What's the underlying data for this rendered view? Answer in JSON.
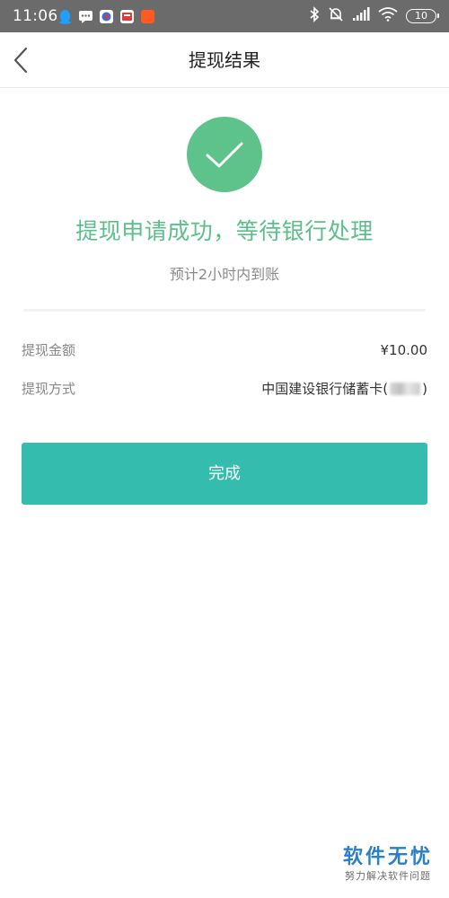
{
  "status_bar": {
    "time": "11:06",
    "battery": "10"
  },
  "header": {
    "title": "提现结果"
  },
  "result": {
    "title": "提现申请成功，等待银行处理",
    "subtitle": "预计2小时内到账"
  },
  "details": [
    {
      "label": "提现金额",
      "value": "¥10.00"
    },
    {
      "label": "提现方式",
      "value_prefix": "中国建设银行储蓄卡(",
      "value_suffix": ")"
    }
  ],
  "actions": {
    "finish_label": "完成"
  },
  "watermark": {
    "title": "软件无忧",
    "subtitle": "努力解决软件问题"
  },
  "colors": {
    "success_green": "#5dc38a",
    "primary_button": "#34bcaf",
    "status_bar_bg": "#6b6b6b"
  },
  "icons": {
    "back": "chevron-left-icon",
    "success": "checkmark-icon"
  }
}
